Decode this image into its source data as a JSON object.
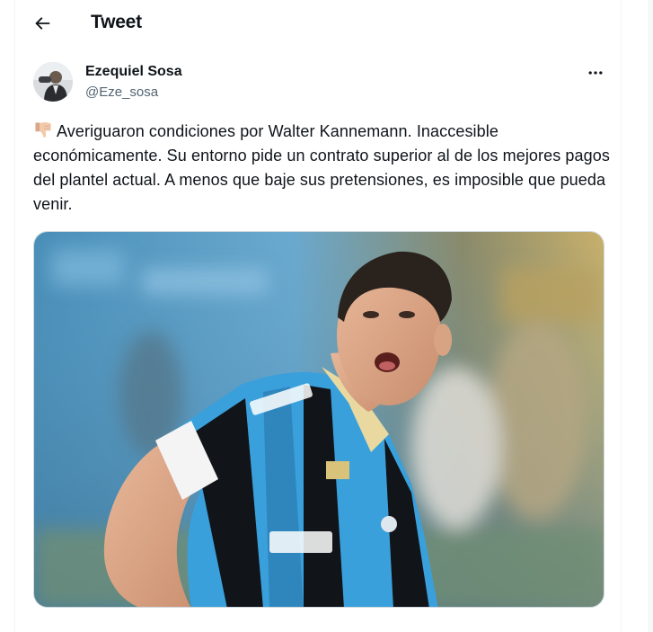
{
  "header": {
    "title": "Tweet"
  },
  "author": {
    "name": "Ezequiel Sosa",
    "handle": "@Eze_sosa"
  },
  "tweet": {
    "emoji": "thumbs-down-icon",
    "text": "Averiguaron condiciones por Walter Kannemann. Inaccesible económicamente. Su entorno pide un contrato superior al de los mejores pagos del plantel actual. A menos que baje sus pretensiones, es imposible que pueda venir."
  },
  "colors": {
    "text": "#0f1419",
    "secondary": "#536471",
    "border": "#cfd9de",
    "jersey_blue": "#3aa0dc",
    "jersey_black": "#111418"
  }
}
